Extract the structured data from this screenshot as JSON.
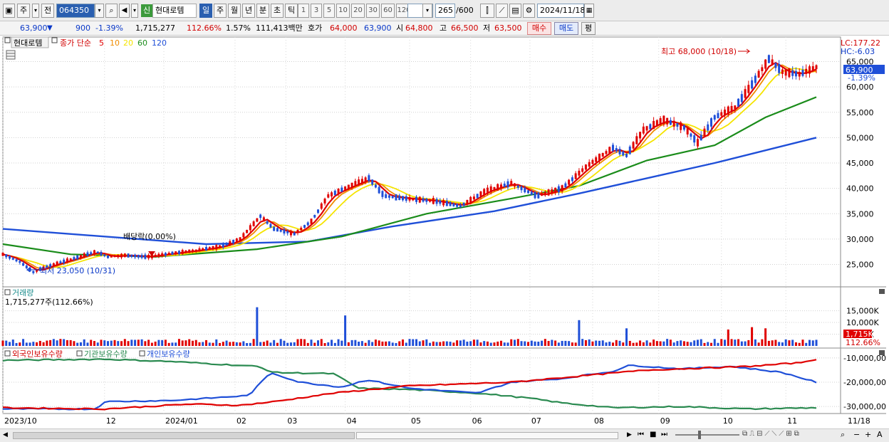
{
  "toolbar": {
    "market": "주",
    "market2": "전",
    "code": "064350",
    "credit_badge": "신",
    "stock_name": "현대로템",
    "periods": [
      "일",
      "주",
      "월",
      "년",
      "분",
      "초",
      "틱"
    ],
    "active_period": "일",
    "intervals": [
      "1",
      "3",
      "5",
      "10",
      "20",
      "30",
      "60",
      "120"
    ],
    "count": "265",
    "count_max": "/600",
    "date": "2024/11/18"
  },
  "quote": {
    "price": "63,900",
    "arrow": "▼",
    "change": "900",
    "change_pct": "-1.39%",
    "volume": "1,715,277",
    "volume_ratio": "112.66%",
    "turnover": "1.57%",
    "amount": "111,413백만",
    "ask_label": "호가",
    "ask_value": "64,000",
    "bid_value": "63,900",
    "open_label": "시",
    "open": "64,800",
    "high_label": "고",
    "high": "66,500",
    "low_label": "저",
    "low": "63,500",
    "buy_btn": "매수",
    "sell_btn": "매도",
    "eval_btn": "평"
  },
  "price_panel": {
    "name_tag": "현대로템",
    "ma_title": "종가 단순",
    "ma_periods": [
      "5",
      "10",
      "20",
      "60",
      "120"
    ],
    "ma_colors": [
      "#e00000",
      "#f08c00",
      "#f5e400",
      "#1a8c1a",
      "#1f4fd8"
    ],
    "lc": "LC:177.22",
    "hc": "HC:-6.03",
    "current_tag": "63,900",
    "current_pct": "-1.39%",
    "high_marker": "최고 68,000 (10/18)",
    "low_marker": "최저 23,050 (10/31)",
    "dividend_marker": "배당락(0.00%)",
    "y_ticks": [
      "65,000",
      "60,000",
      "55,000",
      "50,000",
      "45,000",
      "40,000",
      "35,000",
      "30,000",
      "25,000"
    ]
  },
  "volume_panel": {
    "title": "거래량",
    "value": "1,715,277주(112.66%)",
    "current_tag": "1,715K",
    "current_pct": "112.66%",
    "y_ticks": [
      "15,000K",
      "10,000K",
      "5,000K"
    ]
  },
  "holding_panel": {
    "series": [
      "외국인보유수량",
      "기관보유수량",
      "개인보유수량"
    ],
    "colors": [
      "#e00000",
      "#2a8a50",
      "#1f4fd8"
    ],
    "y_ticks": [
      "-10,000,00",
      "-20,000,00",
      "-30,000,00"
    ]
  },
  "x_axis": {
    "labels": [
      "2023/10",
      "12",
      "2024/01",
      "02",
      "03",
      "04",
      "05",
      "06",
      "07",
      "08",
      "09",
      "10",
      "11"
    ],
    "right_label": "11/18"
  },
  "chart_data": {
    "type": "candlestick",
    "price_range": [
      21000,
      69000
    ],
    "months": [
      {
        "label": "2023/10",
        "close": 24500
      },
      {
        "label": "12",
        "close": 28500
      },
      {
        "label": "2024/01",
        "close": 26500
      },
      {
        "label": "02",
        "close": 28000
      },
      {
        "label": "03",
        "close": 31000
      },
      {
        "label": "04",
        "close": 40000
      },
      {
        "label": "05",
        "close": 38000
      },
      {
        "label": "06",
        "close": 37500
      },
      {
        "label": "07",
        "close": 39000
      },
      {
        "label": "08",
        "close": 46000
      },
      {
        "label": "09",
        "close": 51000
      },
      {
        "label": "10",
        "close": 65000
      },
      {
        "label": "11",
        "close": 63900
      }
    ],
    "price_path": [
      [
        0,
        27000
      ],
      [
        10,
        25500
      ],
      [
        18,
        23500
      ],
      [
        25,
        24500
      ],
      [
        40,
        26000
      ],
      [
        55,
        27500
      ],
      [
        62,
        26500
      ],
      [
        72,
        26800
      ],
      [
        85,
        26500
      ],
      [
        100,
        27200
      ],
      [
        115,
        27800
      ],
      [
        128,
        28500
      ],
      [
        140,
        30000
      ],
      [
        152,
        34500
      ],
      [
        160,
        32000
      ],
      [
        172,
        31000
      ],
      [
        182,
        33500
      ],
      [
        192,
        38500
      ],
      [
        205,
        40500
      ],
      [
        216,
        42000
      ],
      [
        225,
        38500
      ],
      [
        238,
        38000
      ],
      [
        255,
        37500
      ],
      [
        270,
        36500
      ],
      [
        285,
        39500
      ],
      [
        300,
        41000
      ],
      [
        315,
        38500
      ],
      [
        330,
        40000
      ],
      [
        345,
        44500
      ],
      [
        360,
        48000
      ],
      [
        368,
        46500
      ],
      [
        378,
        51500
      ],
      [
        390,
        53500
      ],
      [
        402,
        52000
      ],
      [
        410,
        49000
      ],
      [
        420,
        54000
      ],
      [
        432,
        56000
      ],
      [
        442,
        60500
      ],
      [
        452,
        65500
      ],
      [
        460,
        63000
      ],
      [
        470,
        62500
      ],
      [
        480,
        63900
      ]
    ],
    "ma120_end": 50000,
    "ma60_end": 58000,
    "volume_range": [
      0,
      17000000
    ],
    "volume_spikes": [
      {
        "pos": 150,
        "value": 16500000
      },
      {
        "pos": 202,
        "value": 13000000
      },
      {
        "pos": 211,
        "value": 14000000
      },
      {
        "pos": 305,
        "value": 12500000
      },
      {
        "pos": 340,
        "value": 11000000
      },
      {
        "pos": 368,
        "value": 7500000
      },
      {
        "pos": 428,
        "value": 7000000
      },
      {
        "pos": 442,
        "value": 8000000
      },
      {
        "pos": 450,
        "value": 7500000
      }
    ],
    "holding_range": [
      -32000000,
      -8000000
    ],
    "foreign_path": [
      [
        0,
        -30500000
      ],
      [
        60,
        -31000000
      ],
      [
        110,
        -29000000
      ],
      [
        140,
        -29500000
      ],
      [
        160,
        -28000000
      ],
      [
        195,
        -24500000
      ],
      [
        240,
        -21500000
      ],
      [
        300,
        -20000000
      ],
      [
        340,
        -17500000
      ],
      [
        380,
        -15000000
      ],
      [
        420,
        -14000000
      ],
      [
        440,
        -13500000
      ],
      [
        470,
        -12000000
      ],
      [
        480,
        -10500000
      ]
    ],
    "institution_path": [
      [
        0,
        -11000000
      ],
      [
        60,
        -10500000
      ],
      [
        100,
        -11500000
      ],
      [
        150,
        -13500000
      ],
      [
        160,
        -16000000
      ],
      [
        195,
        -16500000
      ],
      [
        210,
        -22500000
      ],
      [
        240,
        -23000000
      ],
      [
        280,
        -24500000
      ],
      [
        310,
        -26500000
      ],
      [
        330,
        -28500000
      ],
      [
        360,
        -30500000
      ],
      [
        400,
        -30000000
      ],
      [
        440,
        -31000000
      ],
      [
        480,
        -30500000
      ]
    ],
    "individual_path": [
      [
        0,
        -31000000
      ],
      [
        55,
        -31000000
      ],
      [
        60,
        -28000000
      ],
      [
        100,
        -27500000
      ],
      [
        145,
        -25500000
      ],
      [
        158,
        -16000000
      ],
      [
        175,
        -20000000
      ],
      [
        200,
        -22000000
      ],
      [
        215,
        -19000000
      ],
      [
        240,
        -22500000
      ],
      [
        280,
        -24500000
      ],
      [
        300,
        -20000000
      ],
      [
        330,
        -18500000
      ],
      [
        360,
        -15500000
      ],
      [
        370,
        -13000000
      ],
      [
        400,
        -14500000
      ],
      [
        430,
        -13500000
      ],
      [
        460,
        -16000000
      ],
      [
        480,
        -20000000
      ]
    ]
  }
}
